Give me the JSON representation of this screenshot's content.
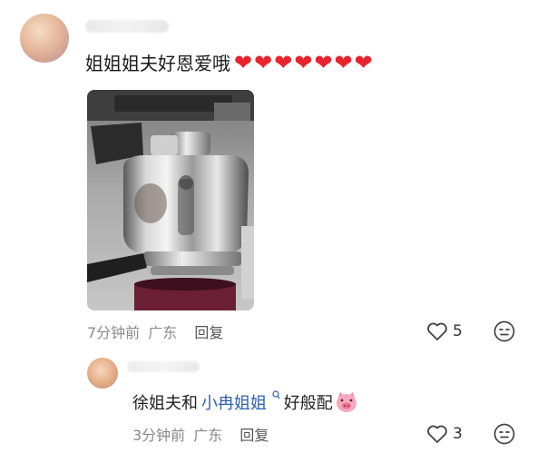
{
  "comment": {
    "text": "姐姐姐夫好恩爱哦",
    "hearts": [
      "❤",
      "❤",
      "❤",
      "❤",
      "❤",
      "❤",
      "❤"
    ],
    "time": "7分钟前",
    "location": "广东",
    "reply_label": "回复",
    "likes": "5"
  },
  "reply": {
    "prefix": "徐姐夫和",
    "mention": "小冉姐姐",
    "mention_icon": "search-icon",
    "suffix": "好般配",
    "emoji": "pig-face-icon",
    "time": "3分钟前",
    "location": "广东",
    "reply_label": "回复",
    "likes": "3"
  }
}
